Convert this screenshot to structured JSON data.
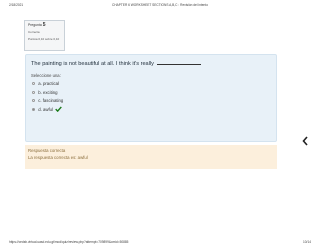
{
  "header": {
    "date": "2/18/2021",
    "title": "CHAPTER 6 WORKSHEET SECTIONS A,B,C : Revisión del intento",
    "pages": ""
  },
  "info": {
    "question_label": "Pregunta",
    "question_number": "5",
    "status": "Correcta",
    "points": "Puntúa 0,10 sobre 0,10"
  },
  "question": {
    "text": "The painting is not beautiful at all. I think it's really",
    "prompt": "Seleccione una:",
    "options": [
      {
        "label": "a. practical"
      },
      {
        "label": "b. exciting"
      },
      {
        "label": "c. fascinating"
      },
      {
        "label": "d. awful"
      }
    ],
    "selected_index": 3
  },
  "feedback": {
    "title": "Respuesta correcta",
    "answer": "La respuesta correcta es: awful"
  },
  "footer": {
    "url": "https://cedsb.virtual.uasd.edu.gt/mod/quiz/review.php?attempt=709899&cmid=50885",
    "page": "10/14"
  },
  "colors": {
    "content_bg": "#e8f1f8",
    "feedback_bg": "#fcefdc",
    "check": "#1a7a1a"
  }
}
